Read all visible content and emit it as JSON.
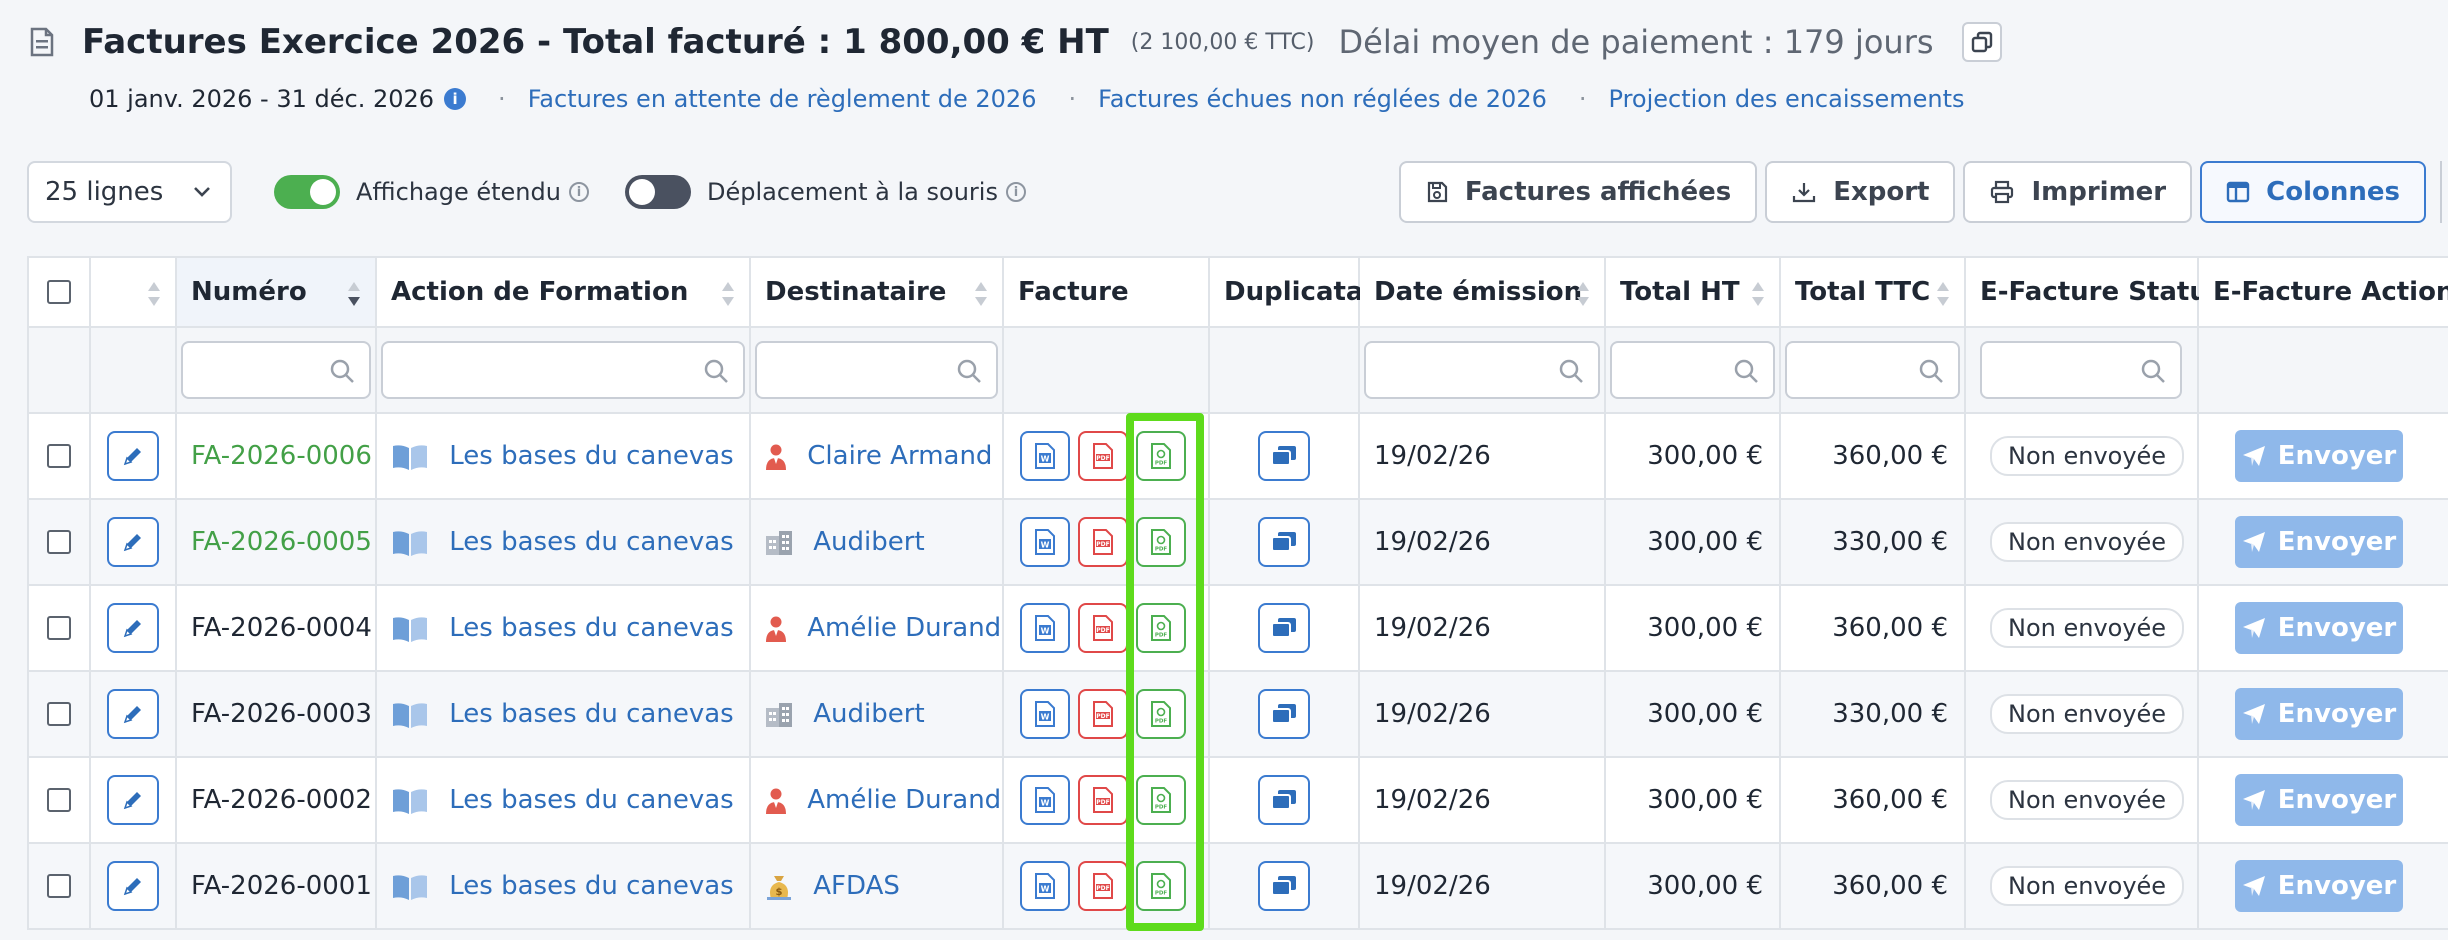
{
  "header": {
    "title": "Factures Exercice 2026 - Total facturé : 1 800,00 € HT",
    "title_ttc": "(2 100,00 € TTC)",
    "delai": "Délai moyen de paiement : 179 jours",
    "period": "01 janv. 2026 - 31 déc. 2026",
    "links": [
      "Factures en attente de règlement de 2026",
      "Factures échues non réglées de 2026",
      "Projection des encaissements"
    ],
    "separator": "·"
  },
  "toolbar": {
    "rows_select": "25 lignes",
    "toggle_extended_label": "Affichage étendu",
    "toggle_extended_on": true,
    "toggle_mouse_label": "Déplacement à la souris",
    "toggle_mouse_on": false,
    "buttons": {
      "displayed": "Factures affichées",
      "export": "Export",
      "print": "Imprimer",
      "columns": "Colonnes"
    }
  },
  "table": {
    "columns": {
      "numero": "Numéro",
      "action": "Action de Formation",
      "destinataire": "Destinataire",
      "facture": "Facture",
      "duplicata": "Duplicata",
      "date": "Date émission",
      "total_ht": "Total HT",
      "total_ttc": "Total TTC",
      "ef_statut": "E-Facture Statut",
      "ef_action": "E-Facture Action"
    },
    "rows": [
      {
        "numero": "FA-2026-0006",
        "numero_color": "green",
        "action": "Les bases du canevas",
        "dest": "Claire Armand",
        "dest_type": "person",
        "date": "19/02/26",
        "ht": "300,00 €",
        "ttc": "360,00 €",
        "statut": "Non envoyée",
        "send": "Envoyer"
      },
      {
        "numero": "FA-2026-0005",
        "numero_color": "green",
        "action": "Les bases du canevas",
        "dest": "Audibert",
        "dest_type": "company",
        "date": "19/02/26",
        "ht": "300,00 €",
        "ttc": "330,00 €",
        "statut": "Non envoyée",
        "send": "Envoyer"
      },
      {
        "numero": "FA-2026-0004",
        "numero_color": "dark",
        "action": "Les bases du canevas",
        "dest": "Amélie Durand",
        "dest_type": "person",
        "date": "19/02/26",
        "ht": "300,00 €",
        "ttc": "360,00 €",
        "statut": "Non envoyée",
        "send": "Envoyer"
      },
      {
        "numero": "FA-2026-0003",
        "numero_color": "dark",
        "action": "Les bases du canevas",
        "dest": "Audibert",
        "dest_type": "company",
        "date": "19/02/26",
        "ht": "300,00 €",
        "ttc": "330,00 €",
        "statut": "Non envoyée",
        "send": "Envoyer"
      },
      {
        "numero": "FA-2026-0002",
        "numero_color": "dark",
        "action": "Les bases du canevas",
        "dest": "Amélie Durand",
        "dest_type": "person",
        "date": "19/02/26",
        "ht": "300,00 €",
        "ttc": "360,00 €",
        "statut": "Non envoyée",
        "send": "Envoyer"
      },
      {
        "numero": "FA-2026-0001",
        "numero_color": "dark",
        "action": "Les bases du canevas",
        "dest": "AFDAS",
        "dest_type": "funder",
        "date": "19/02/26",
        "ht": "300,00 €",
        "ttc": "360,00 €",
        "statut": "Non envoyée",
        "send": "Envoyer"
      }
    ]
  },
  "colors": {
    "accent": "#2d6dba",
    "green": "#43a047",
    "highlight": "#5edb1c",
    "send_button": "#8fb8ea"
  }
}
